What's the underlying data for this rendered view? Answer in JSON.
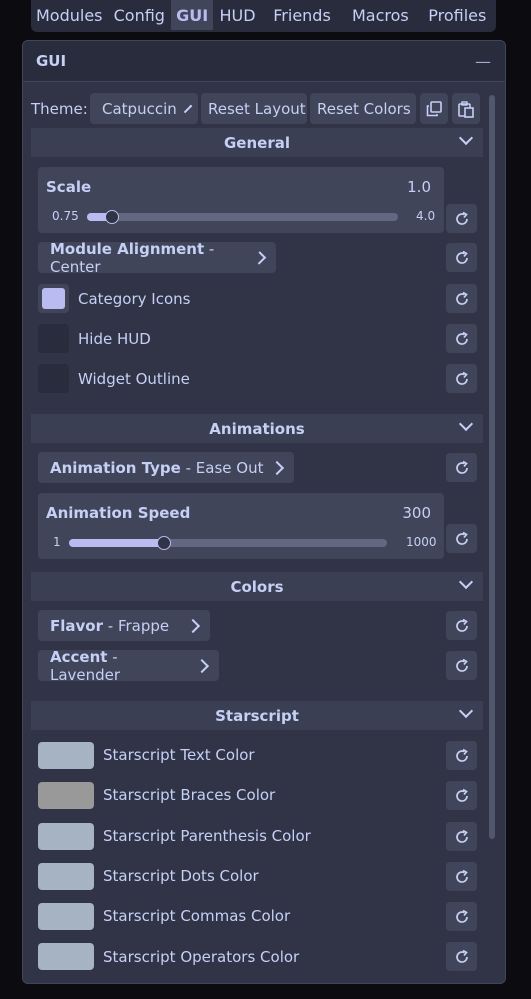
{
  "tabs": [
    {
      "label": "Modules",
      "active": false
    },
    {
      "label": "Config",
      "active": false
    },
    {
      "label": "GUI",
      "active": true
    },
    {
      "label": "HUD",
      "active": false
    },
    {
      "label": "Friends",
      "active": false
    },
    {
      "label": "Macros",
      "active": false
    },
    {
      "label": "Profiles",
      "active": false
    }
  ],
  "window": {
    "title": "GUI",
    "collapse_glyph": "—"
  },
  "theme": {
    "label": "Theme:",
    "value": "Catpuccin",
    "reset_layout": "Reset Layout",
    "reset_colors": "Reset Colors",
    "copy_icon": "copy-icon",
    "paste_icon": "paste-icon"
  },
  "general": {
    "title": "General",
    "scale": {
      "label": "Scale",
      "value": "1.0",
      "min": "0.75",
      "max": "4.0",
      "fraction": 0.08
    },
    "module_alignment": {
      "label": "Module Alignment",
      "value": " - Center"
    },
    "category_icons": {
      "label": "Category Icons",
      "checked": true
    },
    "hide_hud": {
      "label": "Hide HUD",
      "checked": false
    },
    "widget_outline": {
      "label": "Widget Outline",
      "checked": false
    }
  },
  "animations": {
    "title": "Animations",
    "type": {
      "label": "Animation Type",
      "value": " - Ease Out"
    },
    "speed": {
      "label": "Animation Speed",
      "value": "300",
      "min": "1",
      "max": "1000",
      "fraction": 0.3
    }
  },
  "colors": {
    "title": "Colors",
    "flavor": {
      "label": "Flavor",
      "value": " - Frappe"
    },
    "accent": {
      "label": "Accent",
      "value": " - Lavender"
    }
  },
  "starscript": {
    "title": "Starscript",
    "items": [
      {
        "label": "Starscript Text Color",
        "color": "#a5b3c2"
      },
      {
        "label": "Starscript Braces Color",
        "color": "#999999"
      },
      {
        "label": "Starscript Parenthesis Color",
        "color": "#a5b3c2"
      },
      {
        "label": "Starscript Dots Color",
        "color": "#a5b3c2"
      },
      {
        "label": "Starscript Commas Color",
        "color": "#a5b3c2"
      },
      {
        "label": "Starscript Operators Color",
        "color": "#a5b3c2"
      }
    ]
  },
  "colors_theme": {
    "base": "#303446",
    "mantle": "#292c3c",
    "surface": "#414559",
    "text": "#c6d0f5",
    "accent": "#babbf1"
  }
}
